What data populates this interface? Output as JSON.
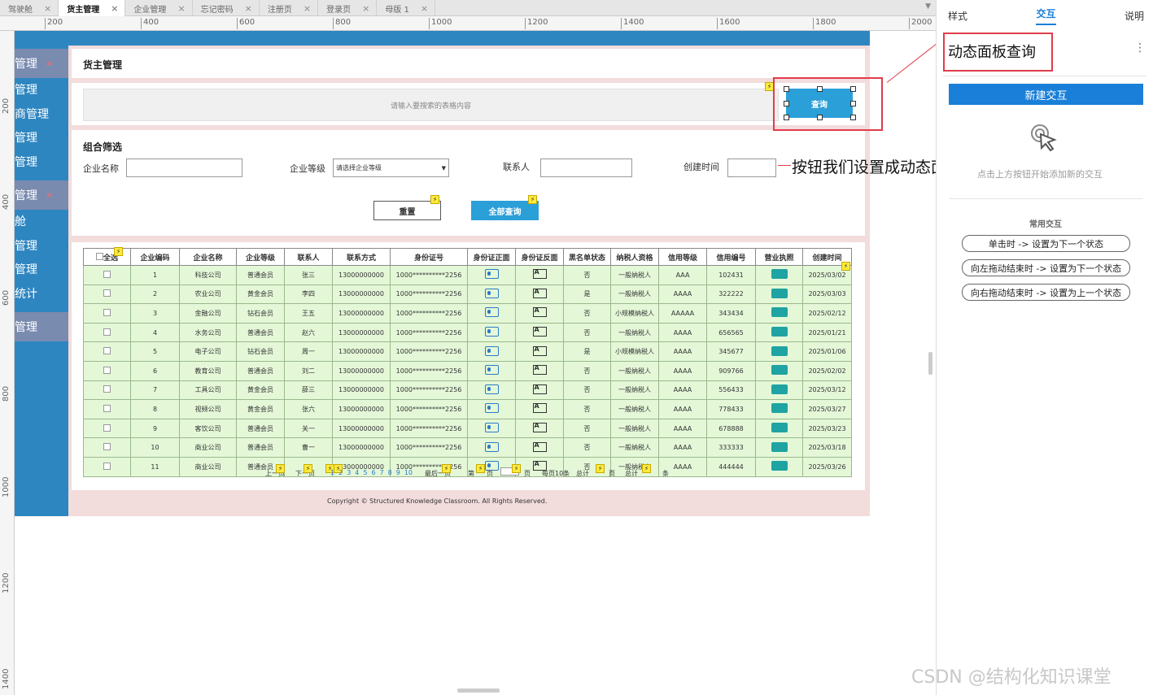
{
  "tabs": [
    {
      "label": "驾驶舱",
      "active": false
    },
    {
      "label": "货主管理",
      "active": true
    },
    {
      "label": "企业管理",
      "active": false
    },
    {
      "label": "忘记密码",
      "active": false
    },
    {
      "label": "注册页",
      "active": false
    },
    {
      "label": "登录页",
      "active": false
    },
    {
      "label": "母版 1",
      "active": false
    }
  ],
  "ruler_h": [
    "200",
    "400",
    "600",
    "800",
    "1000",
    "1200",
    "1400",
    "1600",
    "1800",
    "2000"
  ],
  "ruler_v": [
    "200",
    "400",
    "600",
    "800",
    "1000",
    "1200",
    "1400"
  ],
  "sidebar": {
    "groups": [
      {
        "label": "管理",
        "items": [
          "管理",
          "商管理",
          "管理",
          "管理"
        ]
      },
      {
        "label": "管理",
        "items": [
          "舱",
          "管理",
          "管理",
          "统计"
        ]
      },
      {
        "label": "管理",
        "items": []
      }
    ]
  },
  "page": {
    "title": "货主管理",
    "search_placeholder": "请输入要搜索的表格内容",
    "search_button": "查询",
    "filter_title": "组合筛选",
    "filters": {
      "company_name_label": "企业名称",
      "company_level_label": "企业等级",
      "company_level_value": "请选择企业等级",
      "contact_label": "联系人",
      "created_label": "创建时间"
    },
    "reset_button": "重置",
    "query_all_button": "全部查询",
    "footer": "Copyright © Structured Knowledge Classroom. All Rights Reserved."
  },
  "table": {
    "headers": [
      "全选",
      "企业编码",
      "企业名称",
      "企业等级",
      "联系人",
      "联系方式",
      "身份证号",
      "身份证正面",
      "身份证反面",
      "黑名单状态",
      "纳税人资格",
      "信用等级",
      "信用编号",
      "营业执照",
      "创建时间"
    ],
    "rows": [
      [
        "1",
        "科技公司",
        "普通会员",
        "张三",
        "13000000000",
        "1000**********2256",
        "否",
        "一般纳税人",
        "AAA",
        "102431",
        "2025/03/02"
      ],
      [
        "2",
        "农业公司",
        "黄金会员",
        "李四",
        "13000000000",
        "1000**********2256",
        "是",
        "一般纳税人",
        "AAAA",
        "322222",
        "2025/03/03"
      ],
      [
        "3",
        "金融公司",
        "钻石会员",
        "王五",
        "13000000000",
        "1000**********2256",
        "否",
        "小规模纳税人",
        "AAAAA",
        "343434",
        "2025/02/12"
      ],
      [
        "4",
        "水务公司",
        "普通会员",
        "赵六",
        "13000000000",
        "1000**********2256",
        "否",
        "一般纳税人",
        "AAAA",
        "656565",
        "2025/01/21"
      ],
      [
        "5",
        "电子公司",
        "钻石会员",
        "周一",
        "13000000000",
        "1000**********2256",
        "是",
        "小规模纳税人",
        "AAAA",
        "345677",
        "2025/01/06"
      ],
      [
        "6",
        "教育公司",
        "普通会员",
        "刘二",
        "13000000000",
        "1000**********2256",
        "否",
        "一般纳税人",
        "AAAA",
        "909766",
        "2025/02/02"
      ],
      [
        "7",
        "工具公司",
        "黄金会员",
        "薛三",
        "13000000000",
        "1000**********2256",
        "否",
        "一般纳税人",
        "AAAA",
        "556433",
        "2025/03/12"
      ],
      [
        "8",
        "视频公司",
        "黄金会员",
        "张六",
        "13000000000",
        "1000**********2256",
        "否",
        "一般纳税人",
        "AAAA",
        "778433",
        "2025/03/27"
      ],
      [
        "9",
        "客饮公司",
        "普通会员",
        "关一",
        "13000000000",
        "1000**********2256",
        "否",
        "一般纳税人",
        "AAAA",
        "678888",
        "2025/03/23"
      ],
      [
        "10",
        "商业公司",
        "普通会员",
        "曹一",
        "13000000000",
        "1000**********2256",
        "否",
        "一般纳税人",
        "AAAA",
        "333333",
        "2025/03/18"
      ],
      [
        "11",
        "商业公司",
        "普通会员",
        "",
        "13000000000",
        "1000**********2256",
        "否",
        "一般纳税人",
        "AAAA",
        "444444",
        "2025/03/26"
      ]
    ]
  },
  "pager": {
    "prev": "上一页",
    "next": "下一页",
    "pages": [
      "1",
      "2",
      "3",
      "4",
      "5",
      "6",
      "7",
      "8",
      "9",
      "10"
    ],
    "last": "最后一页",
    "goto_prefix": "第",
    "goto_suffix": "页",
    "per_page": "每页10条",
    "total": "总计",
    "total_pages_suffix": "页",
    "total_count_prefix": "总计",
    "total_count_suffix": "条"
  },
  "annotations": {
    "panel_label": "动态面板查询",
    "button_note": "按钮我们设置成动态面板"
  },
  "right_panel": {
    "tabs": [
      "样式",
      "交互",
      "说明"
    ],
    "new_interaction": "新建交互",
    "hint": "点击上方按钮开始添加新的交互",
    "common_title": "常用交互",
    "common": [
      "单击时 -> 设置为下一个状态",
      "向左拖动结束时 -> 设置为下一个状态",
      "向右拖动结束时 -> 设置为上一个状态"
    ]
  },
  "watermark": "CSDN @结构化知识课堂"
}
